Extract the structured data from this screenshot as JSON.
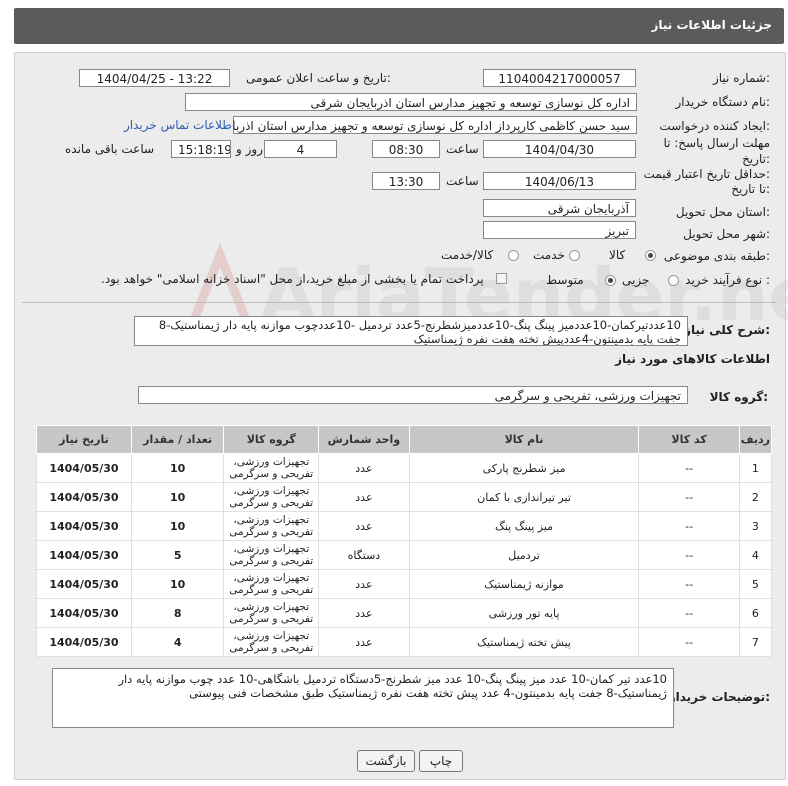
{
  "header": {
    "title": "جزئیات اطلاعات نیاز"
  },
  "form": {
    "need_number_label": "شماره نیاز:",
    "need_number": "1104004217000057",
    "announce_label": "تاریخ و ساعت اعلان عمومی:",
    "announce_value": "1404/04/25 - 13:22",
    "buyer_label": "نام دستگاه خریدار:",
    "buyer_value": "اداره کل نوسازی  توسعه و تجهیز مدارس استان اذربایجان شرقی",
    "creator_label": "ایجاد کننده درخواست:",
    "creator_value": "سید حسن کاظمی کارپرداز اداره کل نوسازی  توسعه و تجهیز مدارس استان اذربایجان شرقی",
    "contact_link": "اطلاعات تماس خریدار",
    "deadline_label_1": "مهلت ارسال پاسخ: تا",
    "deadline_label_2": "تاریخ:",
    "deadline_date": "1404/04/30",
    "time_label": "ساعت",
    "deadline_time": "08:30",
    "days_value": "4",
    "days_label": "روز و",
    "remaining_time": "15:18:19",
    "remaining_label": "ساعت باقی مانده",
    "validity_label_1": "حداقل تاریخ اعتبار قیمت:",
    "validity_label_2": "تا تاریخ:",
    "validity_date": "1404/06/13",
    "validity_time": "13:30",
    "province_label": "استان محل تحویل:",
    "province_value": "آذربایجان شرقی",
    "city_label": "شهر محل تحویل:",
    "city_value": "تبریز",
    "category_label": "طبقه بندی موضوعی:",
    "category_options": [
      "کالا",
      "خدمت",
      "کالا/خدمت"
    ],
    "category_selected": "کالا",
    "process_label": "نوع فرآیند خرید :",
    "process_options": [
      "جزیی",
      "متوسط"
    ],
    "process_selected": "متوسط",
    "payment_note": "پرداخت تمام یا بخشی از مبلغ خرید،از محل \"اسناد خزانه اسلامی\" خواهد بود.",
    "summary_label": "شرح کلی نیاز:",
    "summary_value": "10عددتیرکمان-10عددمیز پینگ پنگ-10عددمیزشطرنج-5عدد تردمیل -10عددچوب موازنه پایه دار ژیمناستیک-8 جفت پایه بدمینتون-4عددپیش تخته هفت نفره ژیمناستیک",
    "items_section_title": "اطلاعات کالاهای مورد نیاز",
    "goods_group_label": "گروه کالا:",
    "goods_group_value": "تجهیزات ورزشی، تفریحی و سرگرمی",
    "buyer_notes_label": "توضیحات خریدار:",
    "buyer_notes_value": "10عدد تیر کمان-10 عدد میز پینگ پنگ-10 عدد میز شطرنج-5دستگاه تردمیل باشگاهی-10 عدد چوب موازنه پایه دار ژیمناستیک-8 جفت پایه بدمینتون-4 عدد پیش تخته هفت نفره ژیمناستیک طبق مشخصات فنی پیوستی"
  },
  "table": {
    "headers": [
      "ردیف",
      "کد کالا",
      "نام کالا",
      "واحد شمارش",
      "گروه کالا",
      "تعداد / مقدار",
      "تاریخ نیاز"
    ],
    "rows": [
      [
        "1",
        "--",
        "میز شطرنج پارکی",
        "عدد",
        "تجهیزات ورزشی، تفریحی و سرگرمی",
        "10",
        "1404/05/30"
      ],
      [
        "2",
        "--",
        "تیر تیراندازی با کمان",
        "عدد",
        "تجهیزات ورزشی، تفریحی و سرگرمی",
        "10",
        "1404/05/30"
      ],
      [
        "3",
        "--",
        "میز پینگ پنگ",
        "عدد",
        "تجهیزات ورزشی، تفریحی و سرگرمی",
        "10",
        "1404/05/30"
      ],
      [
        "4",
        "--",
        "تردمیل",
        "دستگاه",
        "تجهیزات ورزشی، تفریحی و سرگرمی",
        "5",
        "1404/05/30"
      ],
      [
        "5",
        "--",
        "موازنه ژیمناستیک",
        "عدد",
        "تجهیزات ورزشی، تفریحی و سرگرمی",
        "10",
        "1404/05/30"
      ],
      [
        "6",
        "--",
        "پایه تور ورزشی",
        "عدد",
        "تجهیزات ورزشی، تفریحی و سرگرمی",
        "8",
        "1404/05/30"
      ],
      [
        "7",
        "--",
        "پیش تخته ژیمناستیک",
        "عدد",
        "تجهیزات ورزشی، تفریحی و سرگرمی",
        "4",
        "1404/05/30"
      ]
    ]
  },
  "buttons": {
    "back": "بازگشت",
    "print": "چاپ"
  },
  "watermark": {
    "text": "AriaTender.neT"
  }
}
